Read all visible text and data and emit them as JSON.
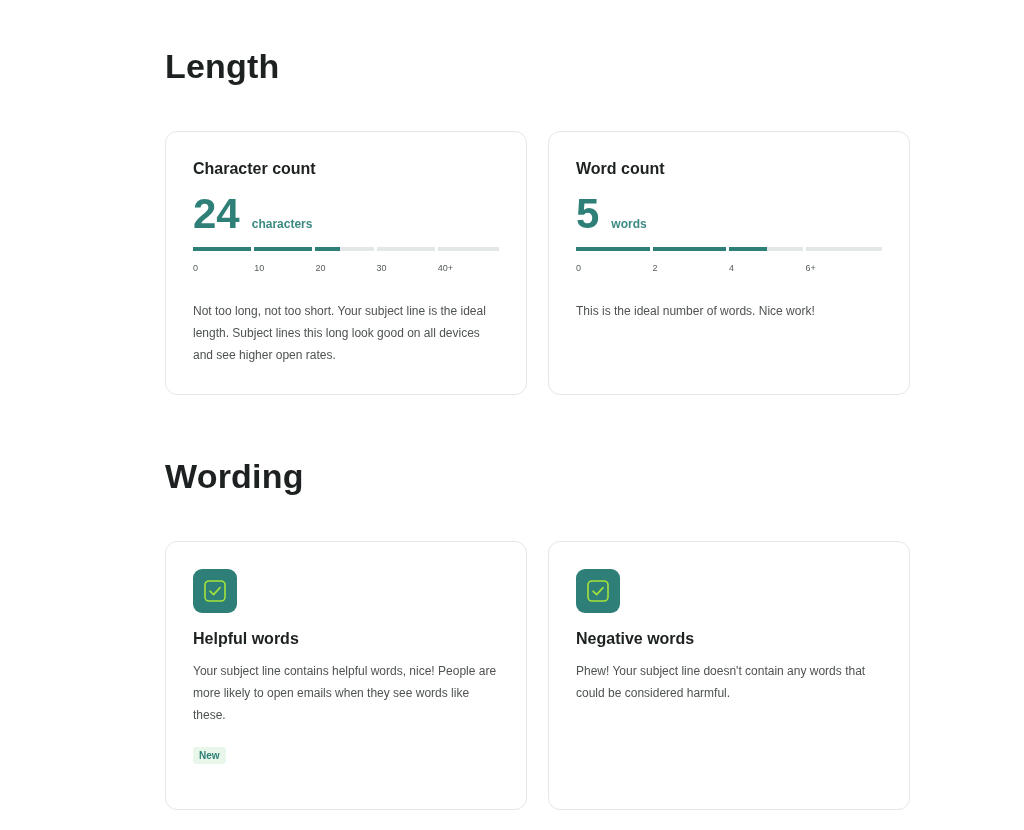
{
  "sections": [
    {
      "title": "Length",
      "cards": [
        {
          "kind": "meter",
          "title": "Character count",
          "value": "24",
          "unit": "characters",
          "level": 0.48,
          "ticks": [
            "0",
            "10",
            "20",
            "30",
            "40+"
          ],
          "description": "Not too long, not too short. Your subject line is the ideal length. Subject lines this long look good on all devices and see higher open rates."
        },
        {
          "kind": "meter",
          "title": "Word count",
          "value": "5",
          "unit": "words",
          "level": 0.625,
          "ticks": [
            "0",
            "2",
            "4",
            "6+"
          ],
          "description": "This is the ideal number of words. Nice work!"
        }
      ]
    },
    {
      "title": "Wording",
      "cards": [
        {
          "kind": "check",
          "title": "Helpful words",
          "description": "Your subject line contains helpful words, nice! People are more likely to open emails when they see words like these.",
          "badge": "New"
        },
        {
          "kind": "check",
          "title": "Negative words",
          "description": "Phew! Your subject line doesn't contain any words that could be considered harmful."
        }
      ]
    }
  ]
}
